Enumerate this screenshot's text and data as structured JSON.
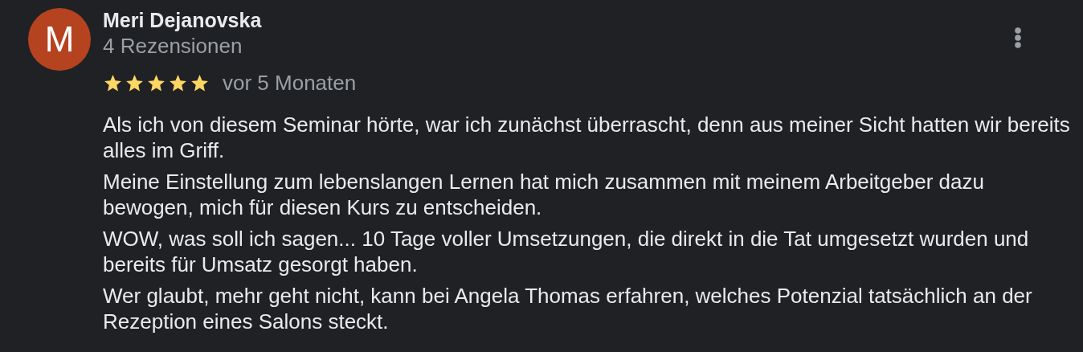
{
  "review": {
    "avatar_letter": "M",
    "author": "Meri Dejanovska",
    "review_count": "4 Rezensionen",
    "stars": 5,
    "time": "vor 5 Monaten",
    "paragraphs": [
      "Als ich von diesem Seminar hörte, war ich zunächst überrascht, denn aus meiner Sicht hatten wir bereits alles im Griff.",
      "Meine Einstellung zum lebenslangen Lernen hat mich zusammen mit meinem Arbeitgeber dazu bewogen, mich für diesen Kurs zu entscheiden.",
      "WOW, was soll ich sagen... 10 Tage voller Umsetzungen, die direkt in die Tat umgesetzt wurden und bereits für Umsatz gesorgt haben.",
      "Wer glaubt, mehr geht nicht, kann bei Angela Thomas erfahren, welches Potenzial tatsächlich an der Rezeption eines Salons steckt."
    ]
  }
}
